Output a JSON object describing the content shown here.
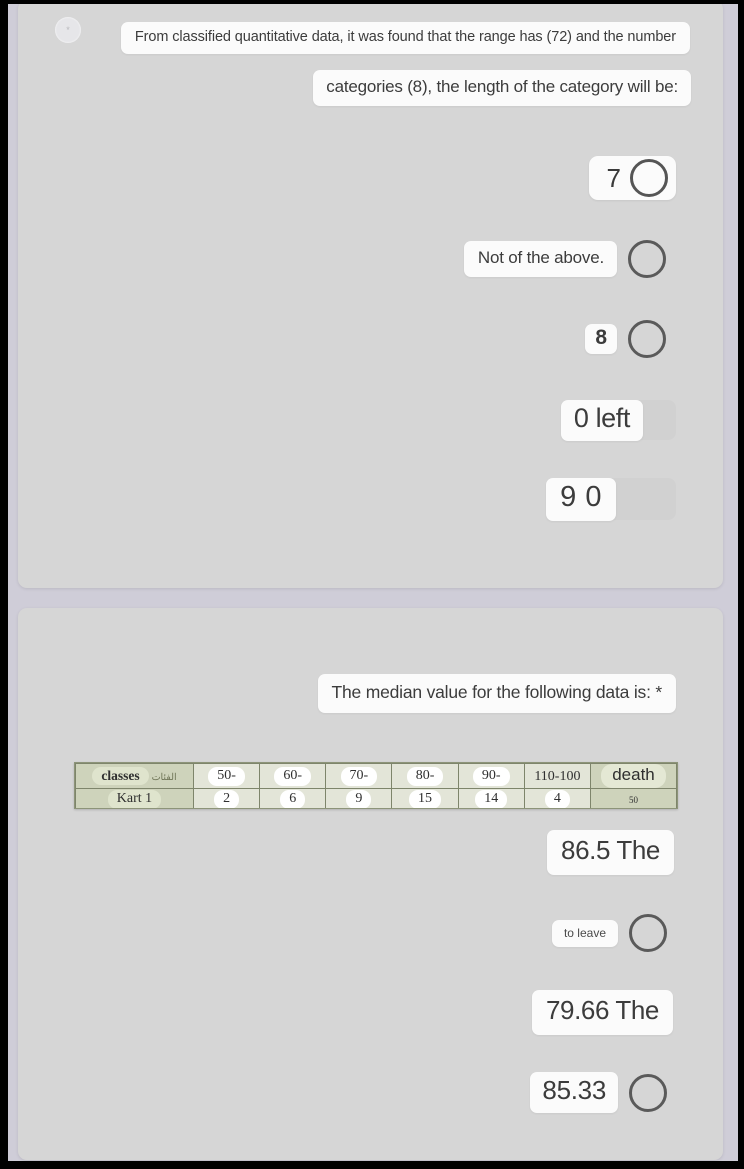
{
  "theme": {
    "frame_color": "#000000",
    "page_background": "#cfcdd8",
    "card_background": "#d6d6d6",
    "pill_background": "#fbfbfb",
    "radio_border": "#5a5a5a",
    "table_header_fill": "#ced3bb",
    "table_body_fill": "#e3e5d8",
    "table_border": "#7e856b"
  },
  "question1": {
    "required_marker": "*",
    "prompt_line1": "From classified quantitative data, it was found that the range has (72) and the number",
    "prompt_line2": "categories (8), the length of the category will be:",
    "options": [
      {
        "label": "7",
        "style": "combined",
        "selected": false
      },
      {
        "label": "Not of the above.",
        "style": "separate",
        "selected": false
      },
      {
        "label": "8",
        "style": "separate",
        "selected": false
      },
      {
        "label": "0 left",
        "style": "ghost",
        "selected": false
      },
      {
        "label": "9 0",
        "style": "ghost",
        "selected": false
      }
    ]
  },
  "question2": {
    "required_marker": "*",
    "prompt": "The median value for the following data is: *",
    "table": {
      "row_header_label": "classes",
      "row_header_sub": "الفئات",
      "row_header_second": "Kart 1",
      "last_column_label": "death",
      "last_column_value": "50",
      "columns": [
        {
          "class": "50-",
          "frequency": "2"
        },
        {
          "class": "60-",
          "frequency": "6"
        },
        {
          "class": "70-",
          "frequency": "9"
        },
        {
          "class": "80-",
          "frequency": "15"
        },
        {
          "class": "90-",
          "frequency": "14"
        },
        {
          "class": "110-100",
          "frequency": "4"
        }
      ]
    },
    "options": [
      {
        "label": "86.5 The",
        "style": "separate",
        "selected": false
      },
      {
        "label": "to leave",
        "style": "separate",
        "selected": false
      },
      {
        "label": "79.66 The",
        "style": "separate",
        "selected": false
      },
      {
        "label": "85.33",
        "style": "separate",
        "selected": false
      }
    ]
  }
}
